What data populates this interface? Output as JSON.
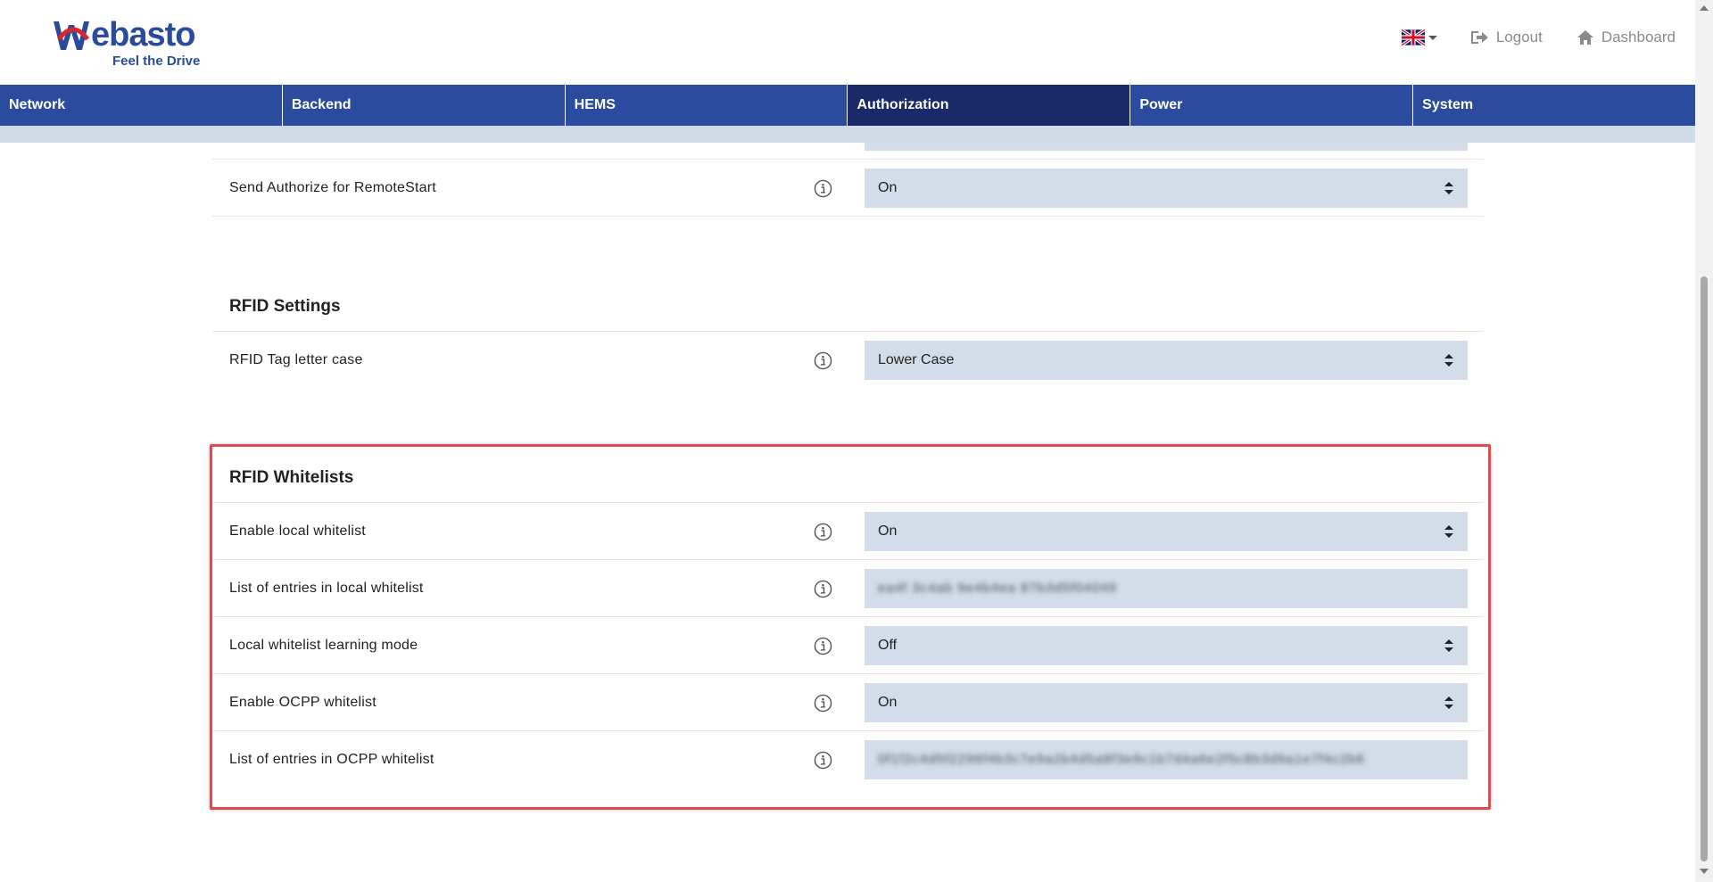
{
  "brand": {
    "name": "Webasto",
    "tagline": "Feel the Drive",
    "color": "#2a4b9b"
  },
  "header": {
    "language_icon": "uk-flag-icon",
    "logout_label": "Logout",
    "dashboard_label": "Dashboard"
  },
  "nav": {
    "tabs": [
      {
        "label": "Network"
      },
      {
        "label": "Backend"
      },
      {
        "label": "HEMS"
      },
      {
        "label": "Authorization",
        "active": true
      },
      {
        "label": "Power"
      },
      {
        "label": "System"
      }
    ],
    "color": "#2b4c9e",
    "active_color": "#1a2a68"
  },
  "settings": {
    "send_authorize": {
      "label": "Send Authorize for RemoteStart",
      "value": "On"
    }
  },
  "rfid_settings": {
    "title": "RFID Settings",
    "tag_letter_case": {
      "label": "RFID Tag letter case",
      "value": "Lower Case"
    }
  },
  "rfid_whitelists": {
    "title": "RFID Whitelists",
    "enable_local": {
      "label": "Enable local whitelist",
      "value": "On"
    },
    "local_entries": {
      "label": "List of entries in local whitelist",
      "value": "ea4f 3c4ab 9e4b4ea 87b3d5f04049"
    },
    "learning_mode": {
      "label": "Local whitelist learning mode",
      "value": "Off"
    },
    "enable_ocpp": {
      "label": "Enable OCPP whitelist",
      "value": "On"
    },
    "ocpp_entries": {
      "label": "List of entries in OCPP whitelist",
      "value": "0f1f2c4d5f2296f4b3c7e9a2b4d5a8f3e9c1b7d4a6e2f5c8b3d9a1e7f4c2b6"
    },
    "highlight_color": "#e04a4e"
  }
}
